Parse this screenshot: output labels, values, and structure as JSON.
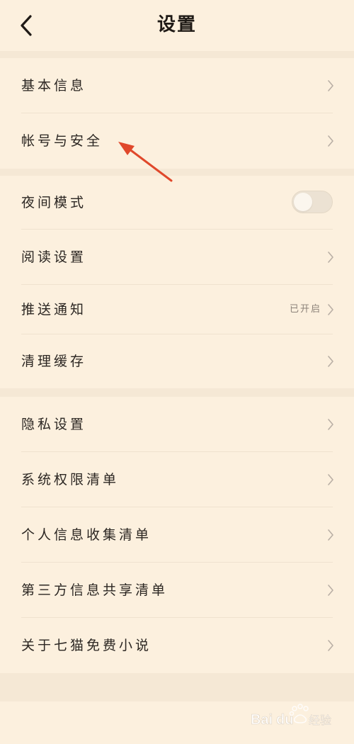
{
  "header": {
    "title": "设置",
    "back_icon": "chevron-left-icon"
  },
  "sections": [
    {
      "items": [
        {
          "label": "基本信息"
        },
        {
          "label": "帐号与安全"
        }
      ]
    },
    {
      "items": [
        {
          "label": "夜间模式",
          "toggle": false
        },
        {
          "label": "阅读设置"
        },
        {
          "label": "推送通知",
          "status": "已开启"
        },
        {
          "label": "清理缓存"
        }
      ]
    },
    {
      "items": [
        {
          "label": "隐私设置"
        },
        {
          "label": "系统权限清单"
        },
        {
          "label": "个人信息收集清单"
        },
        {
          "label": "第三方信息共享清单"
        },
        {
          "label": "关于七猫免费小说"
        }
      ]
    }
  ],
  "colors": {
    "background": "#fcf0de",
    "gap": "#f5e8d5",
    "annotation_arrow": "#e0482b"
  },
  "watermark": "Baidu 经验"
}
